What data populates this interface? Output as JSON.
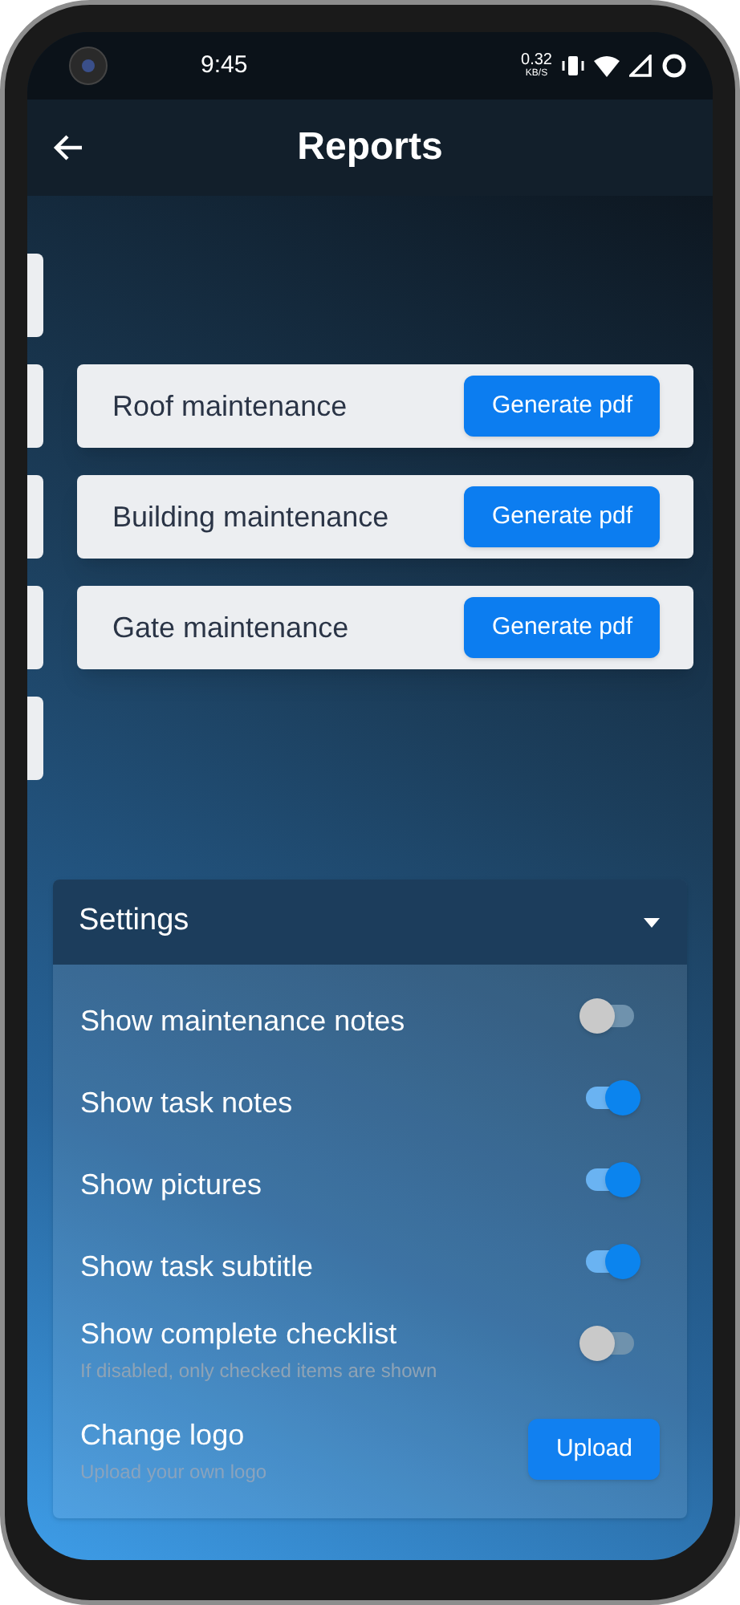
{
  "status_bar": {
    "time": "9:45",
    "net_speed": "0.32",
    "net_unit": "KB/S"
  },
  "header": {
    "title": "Reports"
  },
  "reports": [
    {
      "title": "Roof maintenance",
      "button": "Generate pdf"
    },
    {
      "title": "Building maintenance",
      "button": "Generate pdf"
    },
    {
      "title": "Gate maintenance",
      "button": "Generate pdf"
    }
  ],
  "settings": {
    "title": "Settings",
    "expanded": true,
    "items": [
      {
        "kind": "toggle",
        "label": "Show maintenance notes",
        "on": false
      },
      {
        "kind": "toggle",
        "label": "Show task notes",
        "on": true
      },
      {
        "kind": "toggle",
        "label": "Show pictures",
        "on": true
      },
      {
        "kind": "toggle",
        "label": "Show task subtitle",
        "on": true
      },
      {
        "kind": "toggle",
        "label": "Show complete checklist",
        "hint": "If disabled, only checked items are shown",
        "on": false
      },
      {
        "kind": "upload",
        "label": "Change logo",
        "hint": "Upload your own logo",
        "button": "Upload"
      }
    ]
  }
}
